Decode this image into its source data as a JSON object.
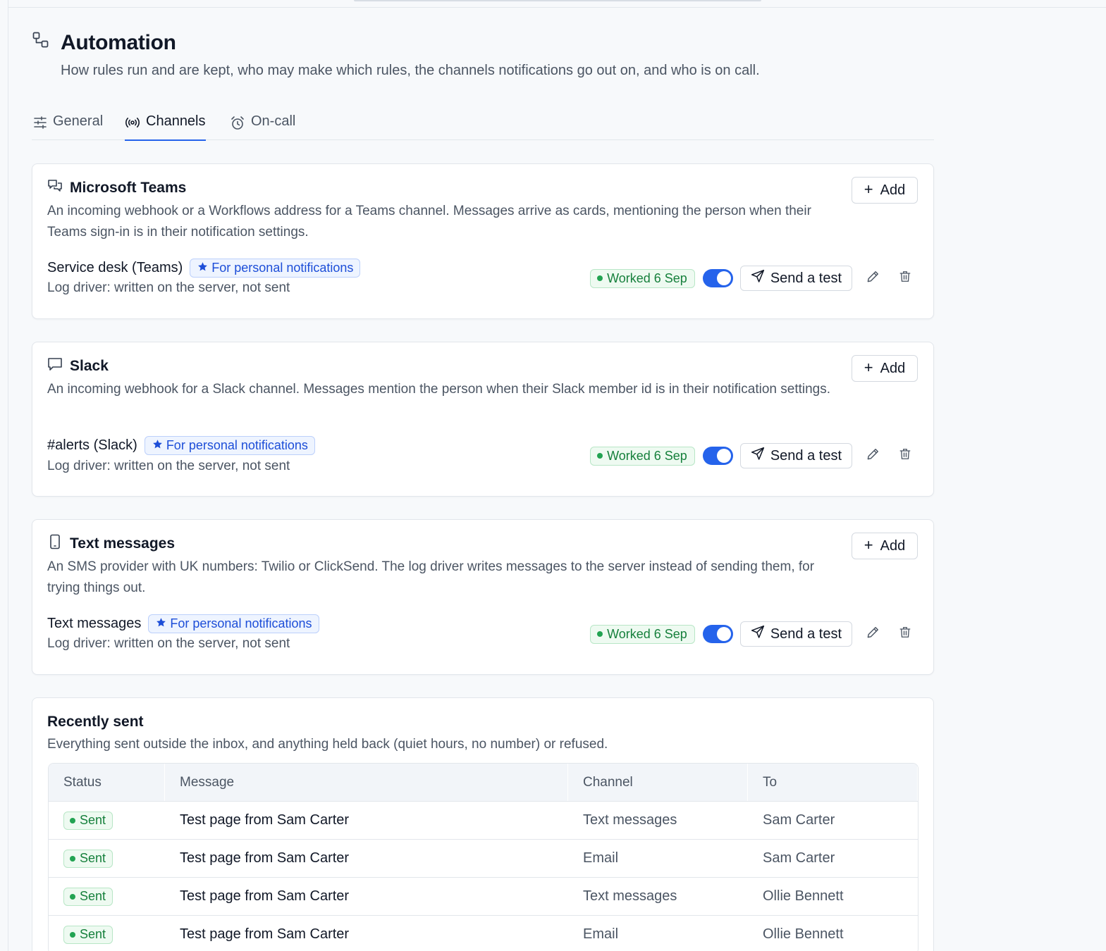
{
  "page": {
    "title": "Automation",
    "subtitle": "How rules run and are kept, who may make which rules, the channels notifications go out on, and who is on call."
  },
  "tabs": [
    {
      "label": "General",
      "icon": "sliders-icon",
      "active": false
    },
    {
      "label": "Channels",
      "icon": "broadcast-icon",
      "active": true
    },
    {
      "label": "On-call",
      "icon": "alarm-clock-icon",
      "active": false
    }
  ],
  "common": {
    "add_label": "Add",
    "send_test_label": "Send a test",
    "personal_badge": "For personal notifications"
  },
  "channels": [
    {
      "title": "Microsoft Teams",
      "icon": "chat-bubbles-icon",
      "description": "An incoming webhook or a Workflows address for a Teams channel. Messages arrive as cards, mentioning the person when their Teams sign-in is in their notification settings.",
      "item": {
        "name": "Service desk (Teams)",
        "detail": "Log driver: written on the server, not sent",
        "status": "Worked 6 Sep",
        "enabled": true
      }
    },
    {
      "title": "Slack",
      "icon": "chat-bubble-icon",
      "description": "An incoming webhook for a Slack channel. Messages mention the person when their Slack member id is in their notification settings.",
      "item": {
        "name": "#alerts (Slack)",
        "detail": "Log driver: written on the server, not sent",
        "status": "Worked 6 Sep",
        "enabled": true
      }
    },
    {
      "title": "Text messages",
      "icon": "phone-icon",
      "description": "An SMS provider with UK numbers: Twilio or ClickSend. The log driver writes messages to the server instead of sending them, for trying things out.",
      "item": {
        "name": "Text messages",
        "detail": "Log driver: written on the server, not sent",
        "status": "Worked 6 Sep",
        "enabled": true
      }
    }
  ],
  "recent": {
    "title": "Recently sent",
    "description": "Everything sent outside the inbox, and anything held back (quiet hours, no number) or refused.",
    "columns": [
      "Status",
      "Message",
      "Channel",
      "To"
    ],
    "rows": [
      {
        "status": "Sent",
        "message": "Test page from Sam Carter",
        "channel": "Text messages",
        "to": "Sam Carter"
      },
      {
        "status": "Sent",
        "message": "Test page from Sam Carter",
        "channel": "Email",
        "to": "Sam Carter"
      },
      {
        "status": "Sent",
        "message": "Test page from Sam Carter",
        "channel": "Text messages",
        "to": "Ollie Bennett"
      },
      {
        "status": "Sent",
        "message": "Test page from Sam Carter",
        "channel": "Email",
        "to": "Ollie Bennett"
      }
    ]
  },
  "colors": {
    "accent": "#2563eb",
    "success": "#16803c",
    "badge_blue": "#1d4ed8"
  }
}
